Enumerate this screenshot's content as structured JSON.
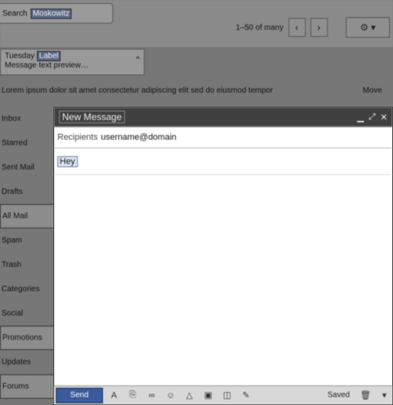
{
  "topbar": {
    "search_text": "Search",
    "search_chip_label": "Moskowitz",
    "pager_text": "1–50 of many",
    "prev_icon": "chevron-left",
    "next_icon": "chevron-right",
    "settings_icon": "gear"
  },
  "snippet": {
    "line1_prefix": "Tuesday",
    "line1_tag": "Label",
    "line2": "Message text preview…",
    "chevron": "chevron-down"
  },
  "label_row": {
    "text": "Lorem ipsum dolor sit amet consectetur adipiscing elit sed do eiusmod tempor",
    "right_text": "Move"
  },
  "left_items": [
    "Inbox",
    "Starred",
    "Sent Mail",
    "Drafts",
    "All Mail",
    "Spam",
    "Trash",
    "Categories",
    "Social",
    "Promotions",
    "Updates",
    "Forums"
  ],
  "compose": {
    "title": "New Message",
    "recipients_label": "Recipients",
    "recipients_value": "username@domain",
    "subject_value": "Hey",
    "send_label": "Send"
  },
  "toolbar_icons": [
    "format-icon",
    "attach-icon",
    "link-icon",
    "emoji-icon",
    "drive-icon",
    "photo-icon",
    "lock-icon",
    "signature-icon"
  ],
  "toolbar_right": {
    "saved_text": "Saved",
    "trash_icon": "trash",
    "more_icon": "more"
  }
}
